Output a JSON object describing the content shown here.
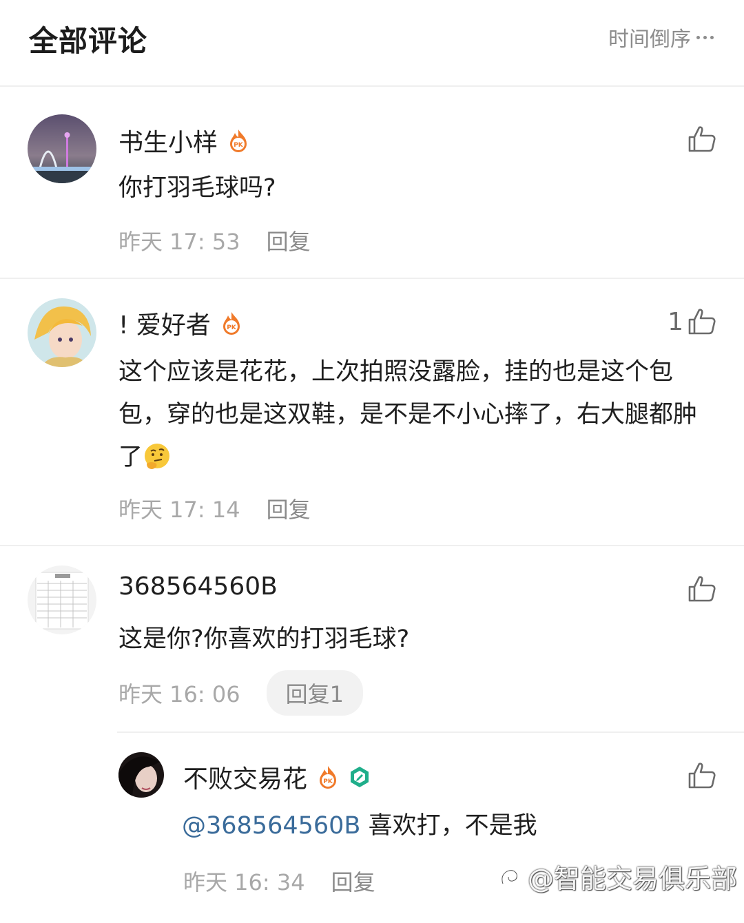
{
  "header": {
    "title": "全部评论",
    "sort_label": "时间倒序"
  },
  "comments": [
    {
      "username": "书生小样",
      "has_pk_badge": true,
      "likes": "",
      "text": "你打羽毛球吗?",
      "time": "昨天 17: 53",
      "reply_label": "回复"
    },
    {
      "username": "! 爱好者",
      "has_pk_badge": true,
      "likes": "1",
      "text": "这个应该是花花，上次拍照没露脸，挂的也是这个包包，穿的也是这双鞋，是不是不小心摔了，右大腿都肿了",
      "emoji": "thinking-face",
      "time": "昨天 17: 14",
      "reply_label": "回复"
    },
    {
      "username": "368564560B",
      "has_pk_badge": false,
      "likes": "",
      "text": "这是你?你喜欢的打羽毛球?",
      "time": "昨天 16: 06",
      "reply_label": "回复1"
    }
  ],
  "reply": {
    "username": "不败交易花",
    "has_pk_badge": true,
    "has_verified_badge": true,
    "likes": "",
    "mention": "@368564560B",
    "text": " 喜欢打，不是我",
    "time": "昨天 16: 34",
    "reply_label": "回复"
  },
  "watermark": "@智能交易俱乐部",
  "colors": {
    "accent_link": "#3a6b9a",
    "pk_badge": "#f07a2a",
    "verified_badge": "#1fae8a",
    "meta_text": "#a8a8a8"
  },
  "icons": [
    "more-icon",
    "thumbs-up-icon",
    "pk-badge-icon",
    "verified-badge-icon",
    "thinking-face-emoji"
  ]
}
